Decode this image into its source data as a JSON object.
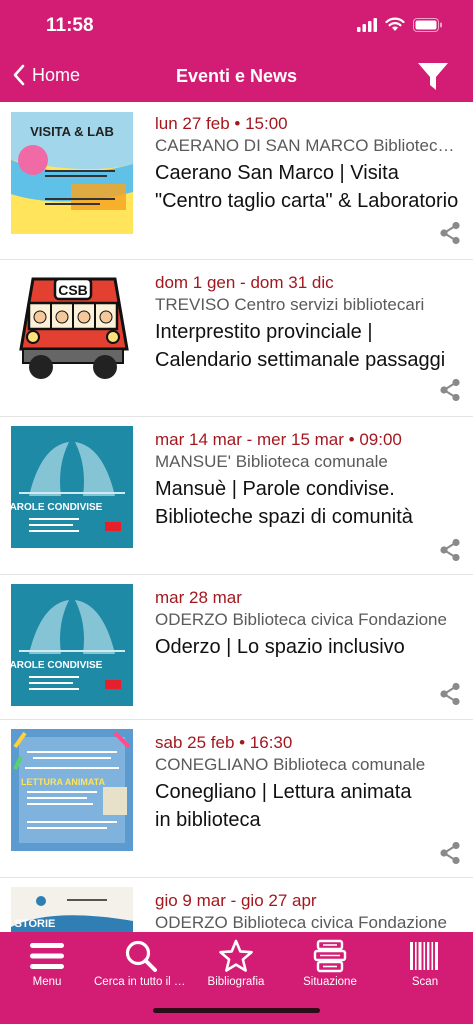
{
  "status": {
    "time": "11:58"
  },
  "nav": {
    "back_label": "Home",
    "title": "Eventi e News"
  },
  "thumbs": {
    "visita_lab": {
      "title": "VISITA & LAB"
    },
    "csb": {
      "text": "CSB"
    },
    "parole": {
      "title": "PAROLE CONDIVISE"
    },
    "lettura": {
      "title": "LETTURA ANIMATA"
    },
    "storie": {
      "title": "STORIE"
    }
  },
  "events": [
    {
      "date": "lun 27 feb • 15:00",
      "place": "CAERANO DI SAN MARCO Biblioteca comunale",
      "title_lines": [
        "Caerano San Marco | Visita",
        "\"Centro taglio carta\" & Laboratorio"
      ]
    },
    {
      "date": "dom 1 gen - dom 31 dic",
      "place": "TREVISO Centro servizi bibliotecari",
      "title_lines": [
        "Interprestito provinciale |",
        "Calendario settimanale passaggi"
      ]
    },
    {
      "date": "mar 14 mar - mer 15 mar • 09:00",
      "place": "MANSUE' Biblioteca comunale",
      "title_lines": [
        "Mansuè | Parole condivise.",
        "Biblioteche spazi di comunità"
      ]
    },
    {
      "date": "mar 28 mar",
      "place": "ODERZO Biblioteca civica Fondazione",
      "title_lines": [
        "Oderzo | Lo spazio inclusivo",
        ""
      ]
    },
    {
      "date": "sab 25 feb • 16:30",
      "place": "CONEGLIANO Biblioteca comunale",
      "title_lines": [
        "Conegliano |  Lettura animata",
        "in biblioteca"
      ]
    },
    {
      "date": "gio 9 mar - gio 27 apr",
      "place": "ODERZO Biblioteca civica Fondazione",
      "title_lines": [
        "",
        ""
      ]
    }
  ],
  "tabs": [
    {
      "label": "Menu",
      "icon": "menu-icon"
    },
    {
      "label": "Cerca in tutto il catalogo",
      "icon": "search-icon"
    },
    {
      "label": "Bibliografia",
      "icon": "star-icon"
    },
    {
      "label": "Situazione",
      "icon": "books-icon"
    },
    {
      "label": "Scan",
      "icon": "barcode-icon"
    }
  ],
  "colors": {
    "brand": "#d31c73",
    "date": "#a3181f",
    "place": "#5a5a5a"
  }
}
